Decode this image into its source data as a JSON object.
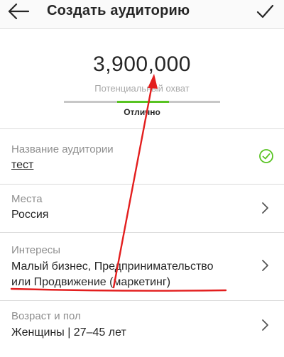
{
  "header": {
    "title": "Создать аудиторию",
    "back_icon": "arrow-left-icon",
    "done_icon": "checkmark-icon"
  },
  "reach": {
    "number": "3,900,000",
    "label": "Потенциальный охват",
    "rating": "Отлично",
    "meter_fill_start": 0.34,
    "meter_fill_end": 0.67
  },
  "rows": [
    {
      "label": "Название аудитории",
      "value": "тест",
      "trailing_icon": "check-circle-icon"
    },
    {
      "label": "Места",
      "value": "Россия",
      "trailing_icon": "chevron-right-icon"
    },
    {
      "label": "Интересы",
      "value_line1": "Малый бизнес, Предпринимательство",
      "value_line2": "или Продвижение (маркетинг)",
      "trailing_icon": "chevron-right-icon"
    },
    {
      "label": "Возраст и пол",
      "value": "Женщины | 27–45 лет",
      "trailing_icon": "chevron-right-icon"
    }
  ],
  "colors": {
    "accent_green": "#58c322",
    "annotation_red": "#e31e1e",
    "text_primary": "#262626",
    "text_secondary": "#8e8e8e"
  }
}
